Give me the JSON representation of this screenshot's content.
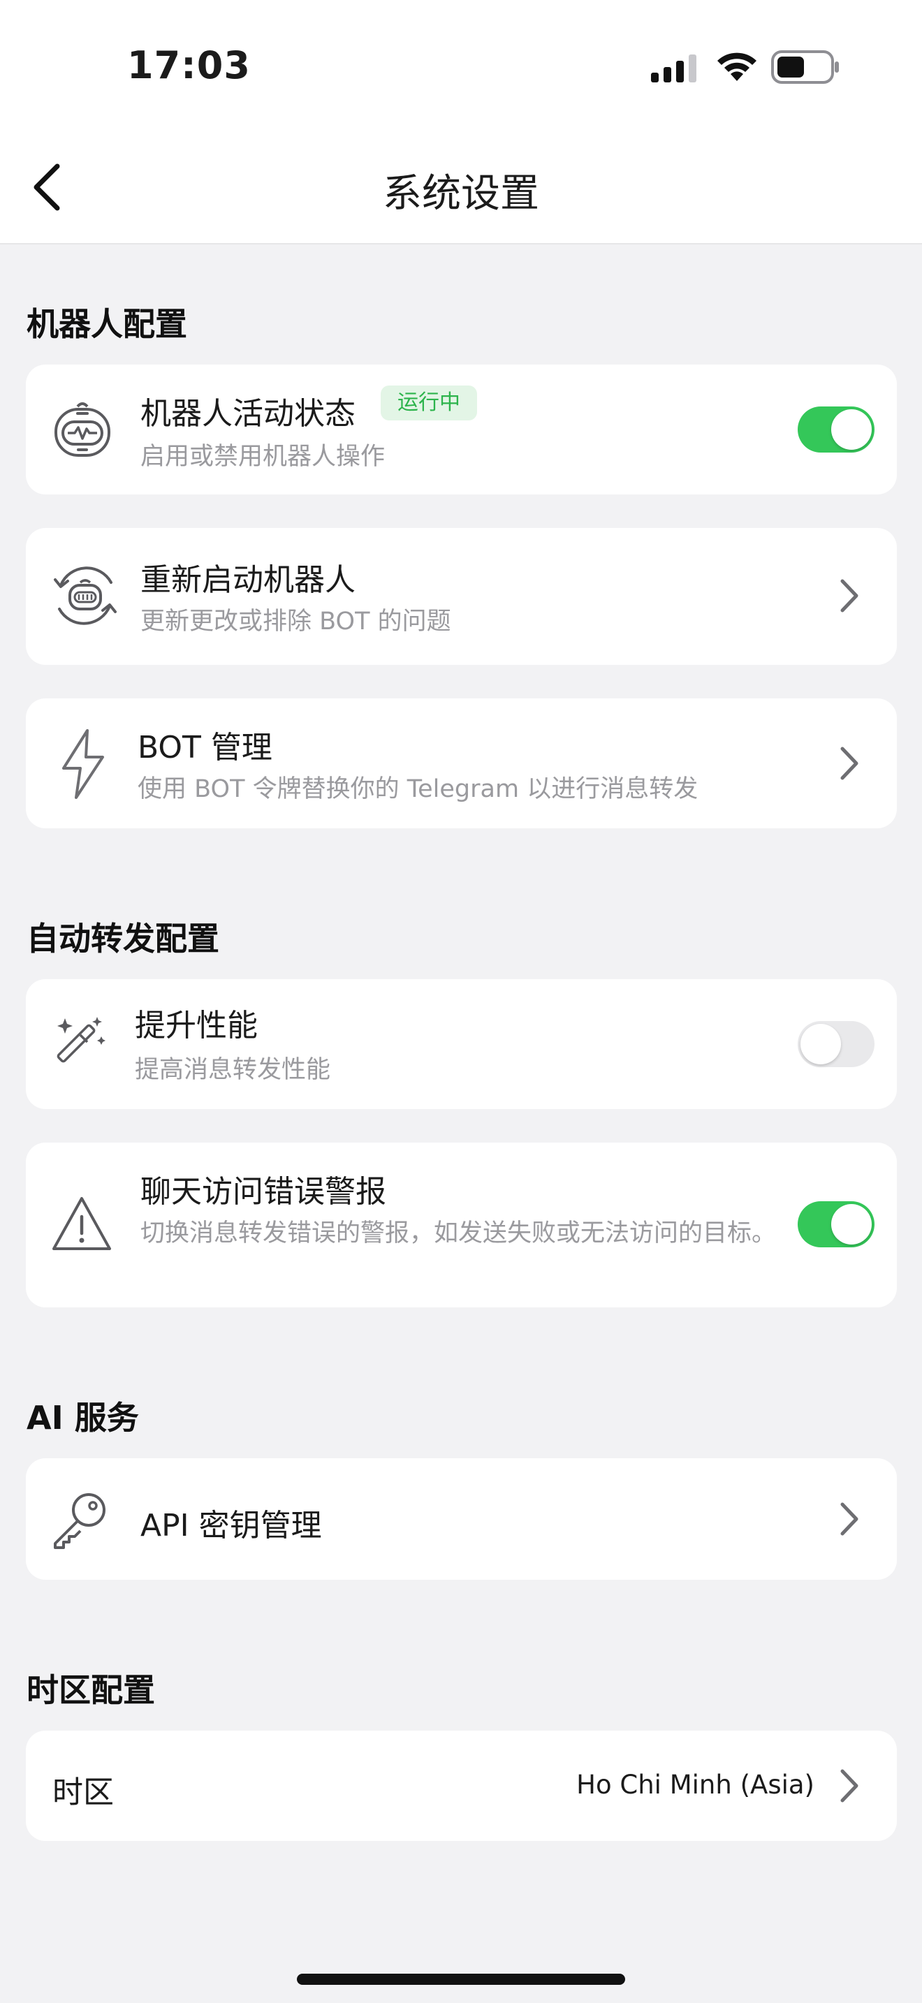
{
  "status_bar": {
    "time": "17:03"
  },
  "header": {
    "title": "系统设置"
  },
  "sections": {
    "robot": {
      "title": "机器人配置",
      "activity": {
        "title": "机器人活动状态",
        "badge": "运行中",
        "subtitle": "启用或禁用机器人操作",
        "enabled": true
      },
      "restart": {
        "title": "重新启动机器人",
        "subtitle": "更新更改或排除 BOT 的问题"
      },
      "bot_manage": {
        "title": "BOT 管理",
        "subtitle": "使用 BOT 令牌替换你的 Telegram 以进行消息转发"
      }
    },
    "forward": {
      "title": "自动转发配置",
      "performance": {
        "title": "提升性能",
        "subtitle": "提高消息转发性能",
        "enabled": false
      },
      "alert": {
        "title": "聊天访问错误警报",
        "subtitle": "切换消息转发错误的警报，如发送失败或无法访问的目标。",
        "enabled": true
      }
    },
    "ai": {
      "title": "AI 服务",
      "api_key": {
        "title": "API 密钥管理"
      }
    },
    "timezone": {
      "title": "时区配置",
      "item": {
        "label": "时区",
        "value": "Ho Chi Minh (Asia)"
      }
    }
  },
  "colors": {
    "accent_green": "#34C759",
    "badge_bg": "#E3F5E6",
    "badge_text": "#2DB44C",
    "background": "#F2F2F4"
  }
}
